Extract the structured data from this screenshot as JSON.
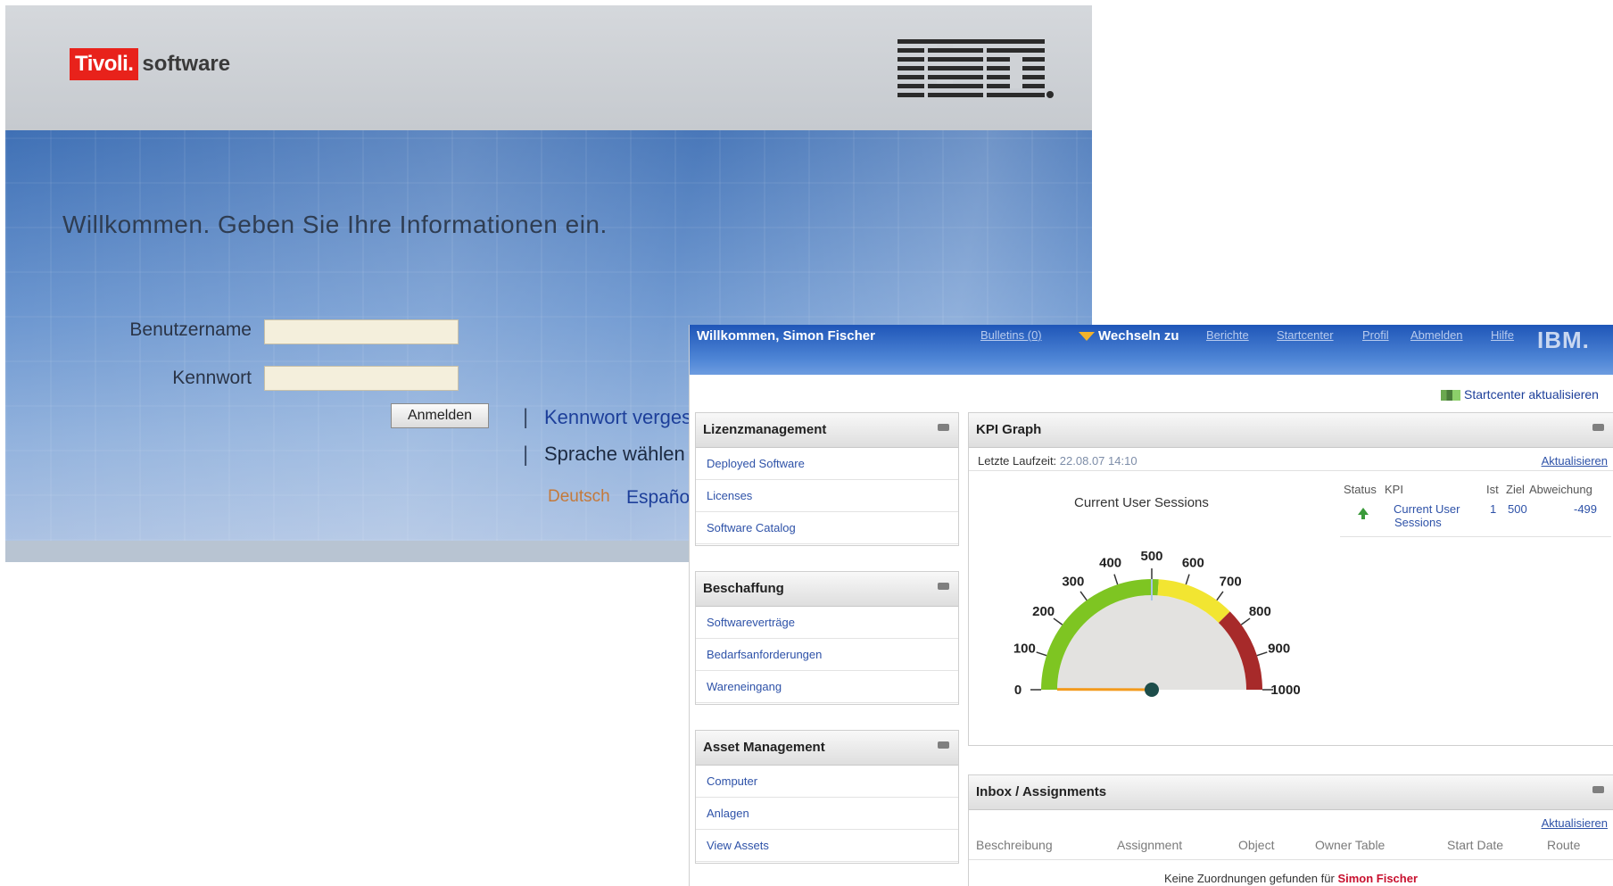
{
  "login": {
    "logo_tivoli": "Tivoli.",
    "logo_software": "software",
    "ibm_logo": "IBM",
    "welcome": "Willkommen. Geben Sie Ihre Informationen ein.",
    "username_label": "Benutzername",
    "password_label": "Kennwort",
    "username_value": "",
    "password_value": "",
    "login_button": "Anmelden",
    "forgot_password": "Kennwort verges",
    "choose_language": "Sprache wählen",
    "languages": [
      "Deutsch",
      "Españo"
    ]
  },
  "startcenter": {
    "welcome": "Willkommen, Simon Fischer",
    "nav": {
      "bulletins": "Bulletins (0)",
      "switch_to": "Wechseln zu",
      "reports": "Berichte",
      "startcenter": "Startcenter",
      "profile": "Profil",
      "logout": "Abmelden",
      "help": "Hilfe",
      "ibm": "IBM."
    },
    "refresh_startcenter": "Startcenter aktualisieren",
    "portlets": [
      {
        "title": "Lizenzmanagement",
        "links": [
          "Deployed Software",
          "Licenses",
          "Software Catalog"
        ]
      },
      {
        "title": "Beschaffung",
        "links": [
          "Softwareverträge",
          "Bedarfsanforderungen",
          "Wareneingang"
        ]
      },
      {
        "title": "Asset Management",
        "links": [
          "Computer",
          "Anlagen",
          "View Assets"
        ]
      }
    ],
    "kpi": {
      "title": "KPI Graph",
      "last_run_label": "Letzte Laufzeit:",
      "last_run_value": "22.08.07 14:10",
      "refresh": "Aktualisieren",
      "gauge_title": "Current User Sessions",
      "gauge_ticks": [
        "0",
        "100",
        "200",
        "300",
        "400",
        "500",
        "600",
        "700",
        "800",
        "900",
        "1000"
      ],
      "gauge_value": 1,
      "gauge_max": 1000,
      "table_headers": [
        "Status",
        "KPI",
        "Ist",
        "Ziel",
        "Abweichung"
      ],
      "row": {
        "kpi_line1": "Current User",
        "kpi_line2": "Sessions",
        "actual": "1",
        "target": "500",
        "deviation": "-499"
      }
    },
    "inbox": {
      "title": "Inbox / Assignments",
      "refresh": "Aktualisieren",
      "columns": [
        "Beschreibung",
        "Assignment",
        "Object",
        "Owner Table",
        "Start Date",
        "Route"
      ],
      "empty_text": "Keine Zuordnungen gefunden für",
      "empty_user": "Simon Fischer"
    },
    "colors": {
      "gauge_green": "#7ec522",
      "gauge_yellow": "#f2e531",
      "gauge_red": "#a72a2a",
      "link_blue": "#2e52a8",
      "tivoli_red": "#e8221b"
    }
  }
}
